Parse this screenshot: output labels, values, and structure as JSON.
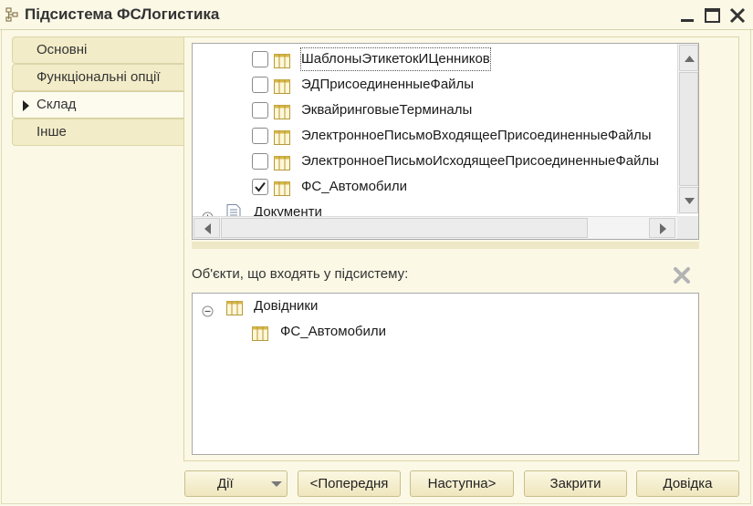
{
  "window": {
    "title": "Підсистема ФСЛогистика"
  },
  "tabs": [
    {
      "label": "Основні",
      "active": false
    },
    {
      "label": "Функціональні опції",
      "active": false
    },
    {
      "label": "Склад",
      "active": true
    },
    {
      "label": "Інше",
      "active": false
    }
  ],
  "tree": {
    "rows": [
      {
        "label": "ШаблоныЭтикетокИЦенников",
        "checked": false,
        "focused": true
      },
      {
        "label": "ЭДПрисоединенныеФайлы",
        "checked": false,
        "focused": false
      },
      {
        "label": "ЭквайринговыеТерминалы",
        "checked": false,
        "focused": false
      },
      {
        "label": "ЭлектронноеПисьмоВходящееПрисоединенныеФайлы",
        "checked": false,
        "focused": false
      },
      {
        "label": "ЭлектронноеПисьмоИсходящееПрисоединенныеФайлы",
        "checked": false,
        "focused": false
      },
      {
        "label": "ФС_Автомобили",
        "checked": true,
        "focused": false
      }
    ],
    "group_row": {
      "label": "Документи"
    }
  },
  "objects": {
    "label": "Об'єкти, що входять у підсистему:",
    "group": "Довідники",
    "items": [
      "ФС_Автомобили"
    ]
  },
  "buttons": {
    "actions": "Дії",
    "prev": "<Попередня",
    "next": "Наступна>",
    "close": "Закрити",
    "help": "Довідка"
  },
  "colors": {
    "background": "#fbf8e6",
    "tab": "#f2ecc8",
    "button_border": "#c9bf8d"
  }
}
